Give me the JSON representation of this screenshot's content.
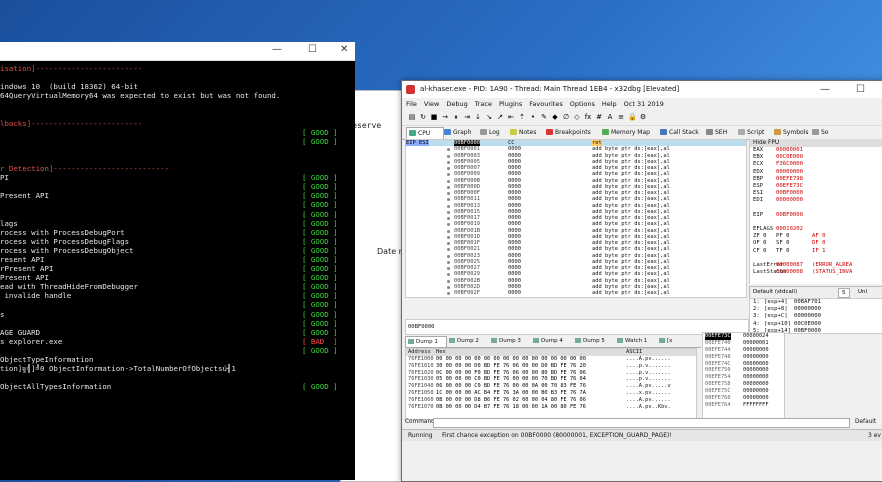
{
  "background_window": {
    "line1": "5]",
    "line2": "ts reserve",
    "line3": "Date mo"
  },
  "console": {
    "controls": [
      "—",
      "☐",
      "✕"
    ],
    "lines": [
      {
        "text": "isation]------------------------",
        "cls": "hdr",
        "status": ""
      },
      {
        "text": "",
        "cls": "",
        "status": ""
      },
      {
        "text": "indows 10  (build 18362) 64-bit",
        "cls": "",
        "status": ""
      },
      {
        "text": "64QueryVirtualMemory64 was expected to exist but was not found.",
        "cls": "",
        "status": ""
      },
      {
        "text": "",
        "cls": "",
        "status": ""
      },
      {
        "text": "",
        "cls": "",
        "status": ""
      },
      {
        "text": "lbacks]-------------------------",
        "cls": "hdr",
        "status": ""
      },
      {
        "text": "",
        "cls": "",
        "status": "[ GOOD ]"
      },
      {
        "text": "",
        "cls": "",
        "status": "[ GOOD ]"
      },
      {
        "text": "",
        "cls": "",
        "status": ""
      },
      {
        "text": "",
        "cls": "",
        "status": ""
      },
      {
        "text": "r Detection]--------------------------",
        "cls": "hdr",
        "status": ""
      },
      {
        "text": "PI",
        "cls": "",
        "status": "[ GOOD ]"
      },
      {
        "text": "",
        "cls": "",
        "status": "[ GOOD ]"
      },
      {
        "text": "Present API",
        "cls": "",
        "status": "[ GOOD ]"
      },
      {
        "text": "",
        "cls": "",
        "status": "[ GOOD ]"
      },
      {
        "text": "",
        "cls": "",
        "status": "[ GOOD ]"
      },
      {
        "text": "lags",
        "cls": "",
        "status": "[ GOOD ]"
      },
      {
        "text": "rocess with ProcessDebugPort",
        "cls": "",
        "status": "[ GOOD ]"
      },
      {
        "text": "rocess with ProcessDebugFlags",
        "cls": "",
        "status": "[ GOOD ]"
      },
      {
        "text": "rocess with ProcessDebugObject",
        "cls": "",
        "status": "[ GOOD ]"
      },
      {
        "text": "resent API",
        "cls": "",
        "status": "[ GOOD ]"
      },
      {
        "text": "rPresent API",
        "cls": "",
        "status": "[ GOOD ]"
      },
      {
        "text": "Present API",
        "cls": "",
        "status": "[ GOOD ]"
      },
      {
        "text": "ead with ThreadHideFromDebugger",
        "cls": "",
        "status": "[ GOOD ]"
      },
      {
        "text": " invalide handle",
        "cls": "",
        "status": "[ GOOD ]"
      },
      {
        "text": "",
        "cls": "",
        "status": "[ GOOD ]"
      },
      {
        "text": "s",
        "cls": "",
        "status": "[ GOOD ]"
      },
      {
        "text": "",
        "cls": "",
        "status": "[ GOOD ]"
      },
      {
        "text": "AGE GUARD",
        "cls": "",
        "status": "[ GOOD ]"
      },
      {
        "text": "s explorer.exe",
        "cls": "",
        "status": "[ BAD  ]"
      },
      {
        "text": "",
        "cls": "",
        "status": "[ GOOD ]"
      },
      {
        "text": "ObjectTypeInformation",
        "cls": "",
        "status": ""
      },
      {
        "text": "tion]╗╣]╝0 ObjectInformation->TotalNumberOfObjectsú╢1",
        "cls": "",
        "status": ""
      },
      {
        "text": "",
        "cls": "",
        "status": ""
      },
      {
        "text": "ObjectAllTypesInformation",
        "cls": "",
        "status": "[ GOOD ]"
      }
    ]
  },
  "debugger": {
    "title": "al-khaser.exe - PID: 1A90 - Thread: Main Thread 1EB4 - x32dbg [Elevated]",
    "window_controls": [
      "—",
      "☐"
    ],
    "menu": [
      "File",
      "View",
      "Debug",
      "Trace",
      "Plugins",
      "Favourites",
      "Options",
      "Help",
      "Oct 31 2019"
    ],
    "toolbar_glyphs": [
      "▤",
      "↻",
      "■",
      "→",
      "⏸",
      "⇥",
      "↓",
      "↘",
      "↗",
      "⇤",
      "⇡",
      "•",
      "✎",
      "◆",
      "∅",
      "◇",
      "fx",
      "#",
      "A",
      "≡",
      "🔒",
      "⚙"
    ],
    "tabs": [
      {
        "label": "CPU",
        "color": "#4a8"
      },
      {
        "label": "Graph",
        "color": "#48c"
      },
      {
        "label": "Log",
        "color": "#999"
      },
      {
        "label": "Notes",
        "color": "#cc4"
      },
      {
        "label": "Breakpoints",
        "color": "#d33"
      },
      {
        "label": "Memory Map",
        "color": "#5a5"
      },
      {
        "label": "Call Stack",
        "color": "#47b"
      },
      {
        "label": "SEH",
        "color": "#888"
      },
      {
        "label": "Script",
        "color": "#aaa"
      },
      {
        "label": "Symbols",
        "color": "#c94"
      },
      {
        "label": "So",
        "color": "#999"
      }
    ],
    "disasm": {
      "label_first": "EIP ESI",
      "selected_row": {
        "addr": "00BF0000",
        "bytes": "CC",
        "instr": "ret"
      },
      "rows_addr": [
        "00BF0001",
        "00BF0003",
        "00BF0005",
        "00BF0007",
        "00BF0009",
        "00BF000B",
        "00BF000D",
        "00BF000F",
        "00BF0011",
        "00BF0013",
        "00BF0015",
        "00BF0017",
        "00BF0019",
        "00BF001B",
        "00BF001D",
        "00BF001F",
        "00BF0021",
        "00BF0023",
        "00BF0025",
        "00BF0027",
        "00BF0029",
        "00BF002B",
        "00BF002D",
        "00BF002F"
      ],
      "row_bytes": "0000",
      "row_instr": "add byte ptr ds:[eax],al"
    },
    "registers": {
      "header": "Hide FPU",
      "rows": [
        {
          "n": "EAX",
          "v": "00000001",
          "x": ""
        },
        {
          "n": "EBX",
          "v": "00C0E000",
          "x": ""
        },
        {
          "n": "ECX",
          "v": "F36C0000",
          "x": ""
        },
        {
          "n": "EDX",
          "v": "00000000",
          "x": ""
        },
        {
          "n": "EBP",
          "v": "00EFE798",
          "x": ""
        },
        {
          "n": "ESP",
          "v": "00EFE73C",
          "x": ""
        },
        {
          "n": "ESI",
          "v": "00BF0000",
          "x": ""
        },
        {
          "n": "EDI",
          "v": "00000000",
          "x": ""
        },
        {
          "n": "",
          "v": "",
          "x": ""
        },
        {
          "n": "EIP",
          "v": "00BF0000",
          "x": ""
        },
        {
          "n": "",
          "v": "",
          "x": ""
        },
        {
          "n": "EFLAGS",
          "v": "00010202",
          "x": ""
        },
        {
          "n": "ZF 0",
          "v": "PF 0",
          "x": "AF 0"
        },
        {
          "n": "OF 0",
          "v": "SF 0",
          "x": "DF 0"
        },
        {
          "n": "CF 0",
          "v": "TF 0",
          "x": "IF 1"
        },
        {
          "n": "",
          "v": "",
          "x": ""
        },
        {
          "n": "LastError",
          "v": "00000087",
          "x": "(ERROR_ALREA"
        },
        {
          "n": "LastStatus",
          "v": "C0000008",
          "x": "(STATUS_INVA"
        }
      ]
    },
    "stack_ctl": {
      "convention": "Default (stdcall)",
      "count": "5",
      "unlock": "Unl"
    },
    "call_args": [
      {
        "n": "1:",
        "v": "[esp+4]",
        "x": "00BAF701"
      },
      {
        "n": "2:",
        "v": "[esp+8]",
        "x": "00000000"
      },
      {
        "n": "3:",
        "v": "[esp+C]",
        "x": "00000000"
      },
      {
        "n": "4:",
        "v": "[esp+10]",
        "x": "00C0E000"
      },
      {
        "n": "5:",
        "v": "[esp+14]",
        "x": "00BF0000"
      }
    ],
    "info_line": "00BF0000",
    "dump_tabs": [
      "Dump 1",
      "Dump 2",
      "Dump 3",
      "Dump 4",
      "Dump 5",
      "Watch 1",
      "[x"
    ],
    "dump": {
      "col_address": "Address",
      "col_hex": "Hex",
      "col_ascii": "ASCII",
      "rows": [
        {
          "a": "76FE1000",
          "h": "00 00 00 00 00 00 00 00 00 00 00 00 00 00 00 00",
          "s": "....A.pv......"
        },
        {
          "a": "76FE1010",
          "h": "30 00 00 00 D0 BD FE 76 06 00 00 D0 BD FE 76 20",
          "s": "....p.v......."
        },
        {
          "a": "76FE1020",
          "h": "0C 00 00 00 F0 BD FE 76 06 00 00 80 BD FE 76 06",
          "s": "....p.v......."
        },
        {
          "a": "76FE1030",
          "h": "05 00 00 00 C0 BD FE 76 00 00 00 70 BD FE 76 04",
          "s": "....p.v......."
        },
        {
          "a": "76FE1040",
          "h": "06 00 00 00 C0 BD FE 76 00 00 0A 00 70 83 FE 76",
          "s": "....A.pv.....v"
        },
        {
          "a": "76FE1050",
          "h": "1C 00 00 00 AC B4 FE 76 3A 00 00 B0 B3 FE 76 7A",
          "s": "....x.pv......"
        },
        {
          "a": "76FE1060",
          "h": "0B 00 00 00 D8 B6 FE 76 02 00 00 04 80 FE 76 06",
          "s": "....A.pv......"
        },
        {
          "a": "76FE1070",
          "h": "0B 00 00 00 D4 B7 FE 76 18 00 00 1A 00 80 FE 76",
          "s": "....A.pv..Kbv."
        }
      ]
    },
    "stack": {
      "rows": [
        {
          "a": "00EFE73C",
          "v": "00000024",
          "sel": true
        },
        {
          "a": "00EFE740",
          "v": "00000001"
        },
        {
          "a": "00EFE744",
          "v": "00000000"
        },
        {
          "a": "00EFE748",
          "v": "00000000"
        },
        {
          "a": "00EFE74C",
          "v": "00000000"
        },
        {
          "a": "00EFE750",
          "v": "00000000"
        },
        {
          "a": "00EFE754",
          "v": "00000000"
        },
        {
          "a": "00EFE758",
          "v": "00000000"
        },
        {
          "a": "00EFE75C",
          "v": "00000000"
        },
        {
          "a": "00EFE760",
          "v": "00000000"
        },
        {
          "a": "00EFE764",
          "v": "FFFFFFFF"
        }
      ]
    },
    "command_label": "Command:",
    "command_default": "Default",
    "status_state": "Running",
    "status_message": "First chance exception on 00BF0000 (80000001, EXCEPTION_GUARD_PAGE)!",
    "status_time": "3 ev"
  },
  "colors": {
    "good": "#3cd43c",
    "bad": "#ff4c4c",
    "header": "#e05050",
    "accent": "#2a6fc7"
  }
}
